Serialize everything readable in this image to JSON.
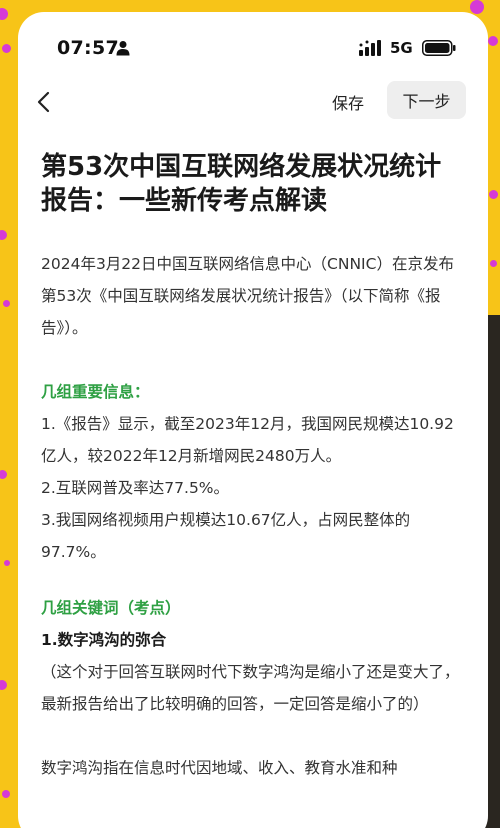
{
  "status_bar": {
    "time": "07:57",
    "network": "5G",
    "icons": [
      "person-icon",
      "signal-icon",
      "battery-icon"
    ]
  },
  "nav": {
    "back_icon": "chevron-left-icon",
    "save_label": "保存",
    "next_label": "下一步"
  },
  "article": {
    "title": "第53次中国互联网络发展状况统计报告：一些新传考点解读",
    "intro": "2024年3月22日中国互联网络信息中心（CNNIC）在京发布第53次《中国互联网络发展状况统计报告》（以下简称《报告》）。",
    "section1_heading": "几组重要信息：",
    "info": [
      "1.《报告》显示，截至2023年12月，我国网民规模达10.92亿人，较2022年12月新增网民2480万人。",
      "2.互联网普及率达77.5%。",
      "3.我国网络视频用户规模达10.67亿人，占网民整体的97.7%。"
    ],
    "section2_heading": "几组关键词（考点）",
    "keyword1_title": "1.数字鸿沟的弥合",
    "keyword1_note": "（这个对于回答互联网时代下数字鸿沟是缩小了还是变大了，最新报告给出了比较明确的回答，一定回答是缩小了的）",
    "keyword1_body": "数字鸿沟指在信息时代因地域、收入、教育水准和种"
  },
  "colors": {
    "background": "#f7c418",
    "dots": "#d63ad6",
    "heading_green": "#2ea043"
  }
}
